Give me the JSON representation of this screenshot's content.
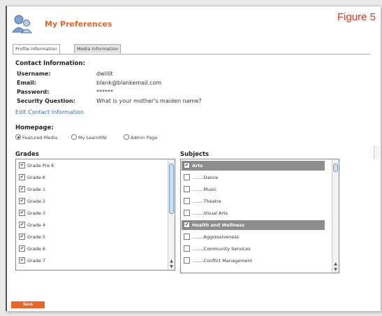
{
  "header": {
    "title": "My Preferences",
    "figure_label": "Figure 5"
  },
  "tabs": [
    "Profile Information",
    "Media Information"
  ],
  "contact": {
    "heading": "Contact Information:",
    "fields": [
      {
        "label": "Username:",
        "value": "dwillit"
      },
      {
        "label": "Email:",
        "value": "blank@blankemail.com"
      },
      {
        "label": "Password:",
        "value": "******"
      },
      {
        "label": "Security Question:",
        "value": "What is your mother's maiden name?"
      }
    ],
    "edit_link": "Edit Contact Information"
  },
  "homepage": {
    "heading": "Homepage:",
    "options": [
      "Featured Media",
      "My LearnItNI",
      "Admin Page"
    ],
    "selected": "Featured Media"
  },
  "grades": {
    "heading": "Grades",
    "items": [
      "Grade Pre K",
      "Grade K",
      "Grade 1",
      "Grade 2",
      "Grade 3",
      "Grade 4",
      "Grade 5",
      "Grade 6",
      "Grade 7"
    ]
  },
  "subjects": {
    "heading": "Subjects",
    "items": [
      {
        "label": "Arts",
        "category": true,
        "checked": true
      },
      {
        "label": "........Dance",
        "category": false,
        "checked": false
      },
      {
        "label": "........Music",
        "category": false,
        "checked": false
      },
      {
        "label": "........Theatre",
        "category": false,
        "checked": false
      },
      {
        "label": "........Visual Arts",
        "category": false,
        "checked": false
      },
      {
        "label": "Health and Wellness",
        "category": true,
        "checked": true
      },
      {
        "label": "........Aggressiveness",
        "category": false,
        "checked": false
      },
      {
        "label": "........Community Services",
        "category": false,
        "checked": false
      },
      {
        "label": "........Conflict Management",
        "category": false,
        "checked": false
      }
    ]
  },
  "save_label": "Save",
  "colors": {
    "accent": "#e8652a",
    "figure_label": "#e8321a",
    "link": "#3a6ea5",
    "category_row": "#8d8d8d"
  },
  "icons": {
    "app_icon": "users-icon",
    "check_mark": "✔"
  }
}
